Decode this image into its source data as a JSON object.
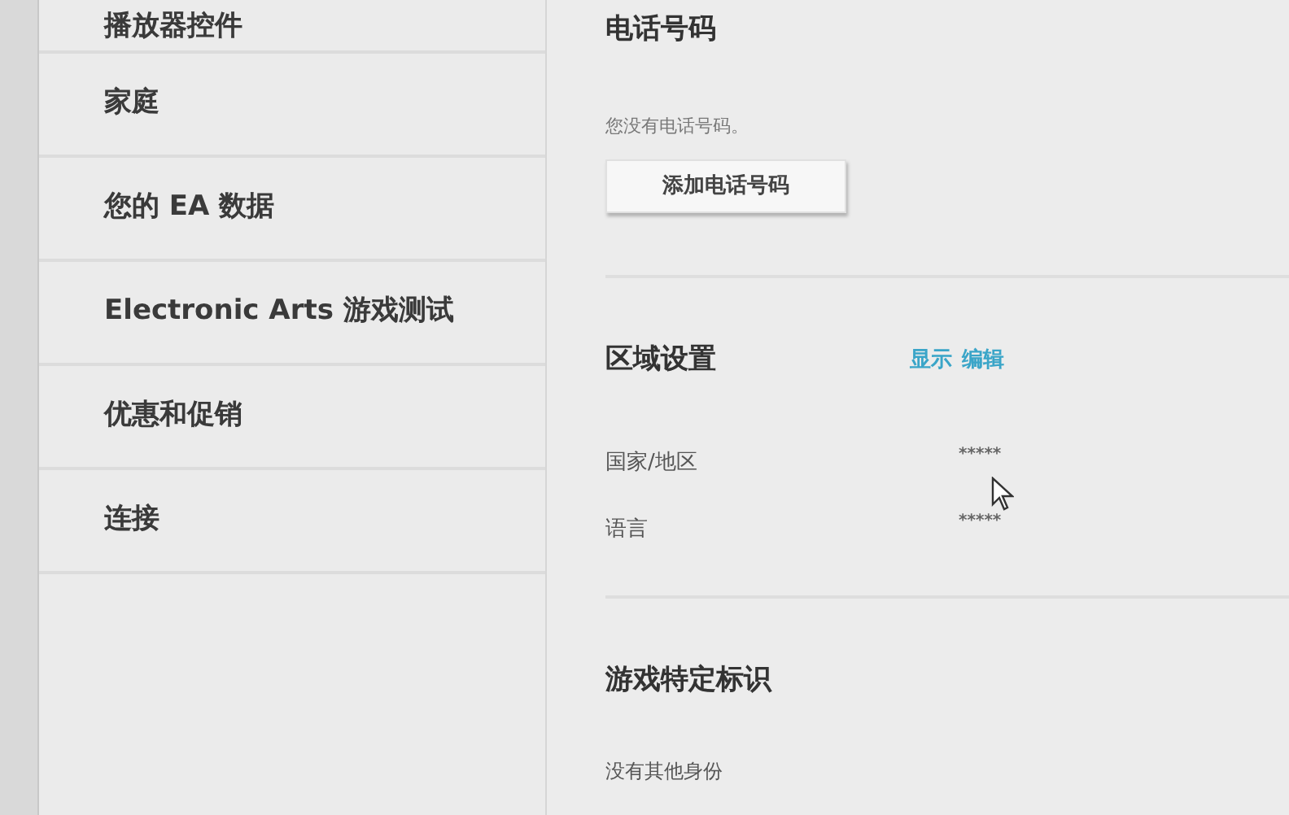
{
  "sidebar": {
    "items": [
      {
        "label": "播放器控件"
      },
      {
        "label": "家庭"
      },
      {
        "label": "您的 EA 数据"
      },
      {
        "label": "Electronic Arts 游戏测试"
      },
      {
        "label": "优惠和促销"
      },
      {
        "label": "连接"
      }
    ]
  },
  "sections": [
    {
      "kind": "phone",
      "title": "电话号码",
      "message": "您没有电话号码。",
      "button": "添加电话号码"
    },
    {
      "kind": "region",
      "title": "区域设置",
      "links": [
        "显示",
        "编辑"
      ],
      "fields": [
        {
          "label": "国家/地区",
          "value": "*****"
        },
        {
          "label": "语言",
          "value": "*****"
        }
      ]
    },
    {
      "kind": "ids",
      "title": "游戏特定标识",
      "message": "没有其他身份"
    }
  ]
}
